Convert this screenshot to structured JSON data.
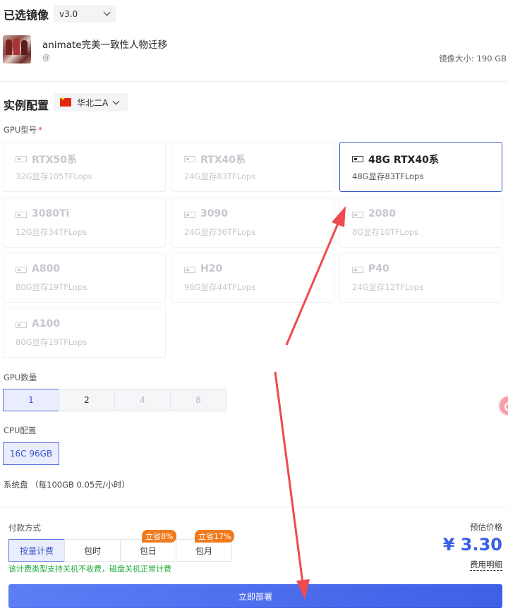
{
  "image_section": {
    "title": "已选镜像",
    "version": "v3.0",
    "name": "animate完美一致性人物迁移",
    "author": "@",
    "size_label": "镜像大小: 190 GB"
  },
  "instance": {
    "title": "实例配置",
    "region": "华北二A",
    "gpu_model_label": "GPU型号",
    "required_mark": "*",
    "gpus": [
      {
        "name": "RTX50系",
        "spec": "32G显存105TFLops",
        "selected": false
      },
      {
        "name": "RTX40系",
        "spec": "24G显存83TFLops",
        "selected": false
      },
      {
        "name": "48G RTX40系",
        "spec": "48G显存83TFLops",
        "selected": true
      },
      {
        "name": "3080Ti",
        "spec": "12G显存34TFLops",
        "selected": false
      },
      {
        "name": "3090",
        "spec": "24G显存36TFLops",
        "selected": false
      },
      {
        "name": "2080",
        "spec": "8G显存10TFLops",
        "selected": false
      },
      {
        "name": "A800",
        "spec": "80G显存19TFLops",
        "selected": false
      },
      {
        "name": "H20",
        "spec": "96G显存44TFLops",
        "selected": false
      },
      {
        "name": "P40",
        "spec": "24G显存12TFLops",
        "selected": false
      },
      {
        "name": "A100",
        "spec": "80G显存19TFLops",
        "selected": false
      }
    ],
    "gpu_count_label": "GPU数量",
    "gpu_counts": [
      "1",
      "2",
      "4",
      "8"
    ],
    "cpu_label": "CPU配置",
    "cpu_option": "16C 96GB",
    "disk_label": "系统盘 （每100GB 0.05元/小时）"
  },
  "payment": {
    "label": "付款方式",
    "options": [
      "按量计费",
      "包时",
      "包日",
      "包月"
    ],
    "badges": [
      "立省8%",
      "立省17%"
    ],
    "note": "该计费类型支持关机不收费，磁盘关机正常计费",
    "est_label": "预估价格",
    "price": "¥ 3.30",
    "detail_link": "费用明细",
    "deploy_button": "立即部署"
  },
  "colors": {
    "accent": "#3a57c9",
    "price": "#3a5ee8",
    "badge": "#f07b1e",
    "note": "#1faa3a",
    "arrow": "#ee4a4f"
  }
}
